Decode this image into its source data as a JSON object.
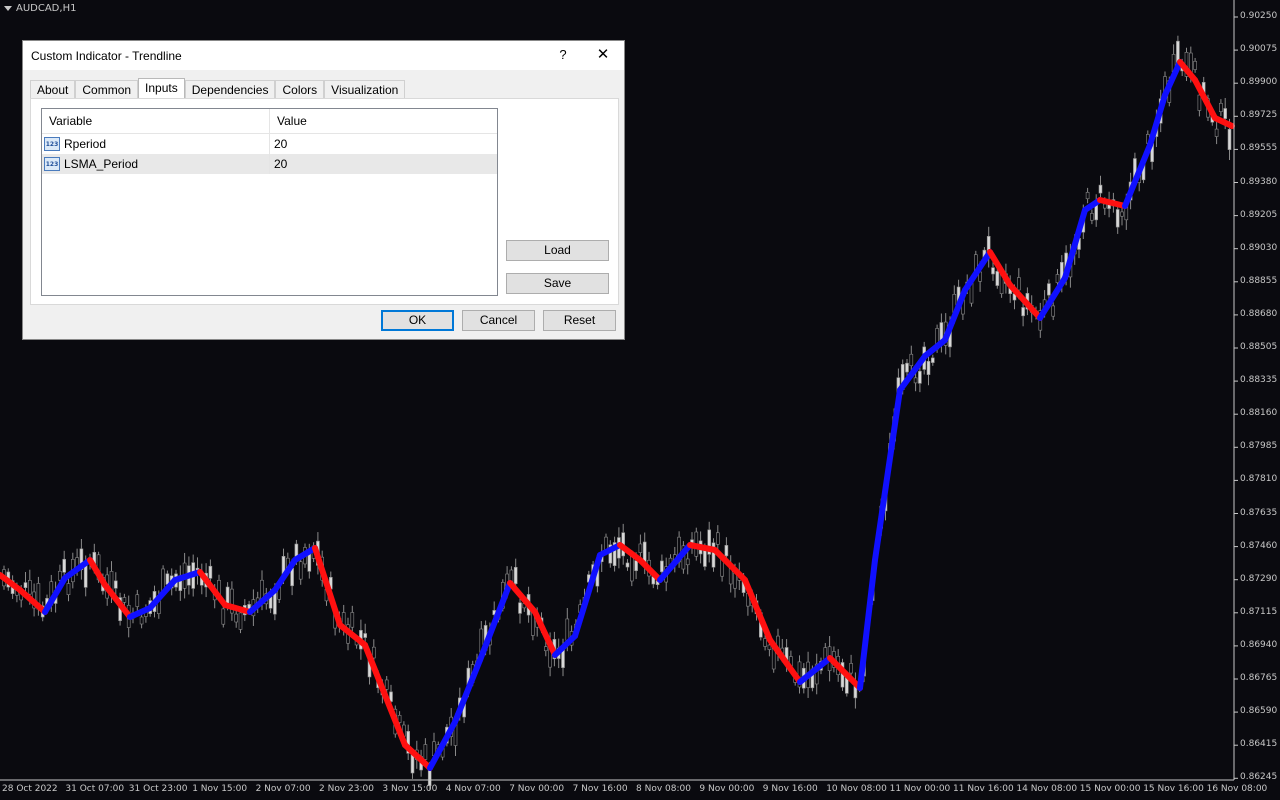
{
  "chart": {
    "symbol": "AUDCAD,H1",
    "y_ticks": [
      "0.90250",
      "0.90075",
      "0.89900",
      "0.89725",
      "0.89555",
      "0.89380",
      "0.89205",
      "0.89030",
      "0.88855",
      "0.88680",
      "0.88505",
      "0.88335",
      "0.88160",
      "0.87985",
      "0.87810",
      "0.87635",
      "0.87460",
      "0.87290",
      "0.87115",
      "0.86940",
      "0.86765",
      "0.86590",
      "0.86415",
      "0.86245"
    ],
    "x_ticks": [
      "28 Oct 2022",
      "31 Oct 07:00",
      "31 Oct 23:00",
      "1 Nov 15:00",
      "2 Nov 07:00",
      "2 Nov 23:00",
      "3 Nov 15:00",
      "4 Nov 07:00",
      "7 Nov 00:00",
      "7 Nov 16:00",
      "8 Nov 08:00",
      "9 Nov 00:00",
      "9 Nov 16:00",
      "10 Nov 08:00",
      "11 Nov 00:00",
      "11 Nov 16:00",
      "14 Nov 08:00",
      "15 Nov 00:00",
      "15 Nov 16:00",
      "16 Nov 08:00"
    ],
    "colors": {
      "background": "#0a0a0f",
      "candle": "#8a8a8a",
      "up": "#1010ff",
      "down": "#ff1010",
      "text": "#c8c8c8"
    }
  },
  "dialog": {
    "title": "Custom Indicator - Trendline",
    "help": "?",
    "close": "✕",
    "tabs": [
      "About",
      "Common",
      "Inputs",
      "Dependencies",
      "Colors",
      "Visualization"
    ],
    "active_tab": "Inputs",
    "columns": {
      "variable": "Variable",
      "value": "Value"
    },
    "rows": [
      {
        "variable": "Rperiod",
        "value": "20",
        "icon": "123"
      },
      {
        "variable": "LSMA_Period",
        "value": "20",
        "icon": "123"
      }
    ],
    "buttons": {
      "load": "Load",
      "save": "Save",
      "ok": "OK",
      "cancel": "Cancel",
      "reset": "Reset"
    }
  }
}
